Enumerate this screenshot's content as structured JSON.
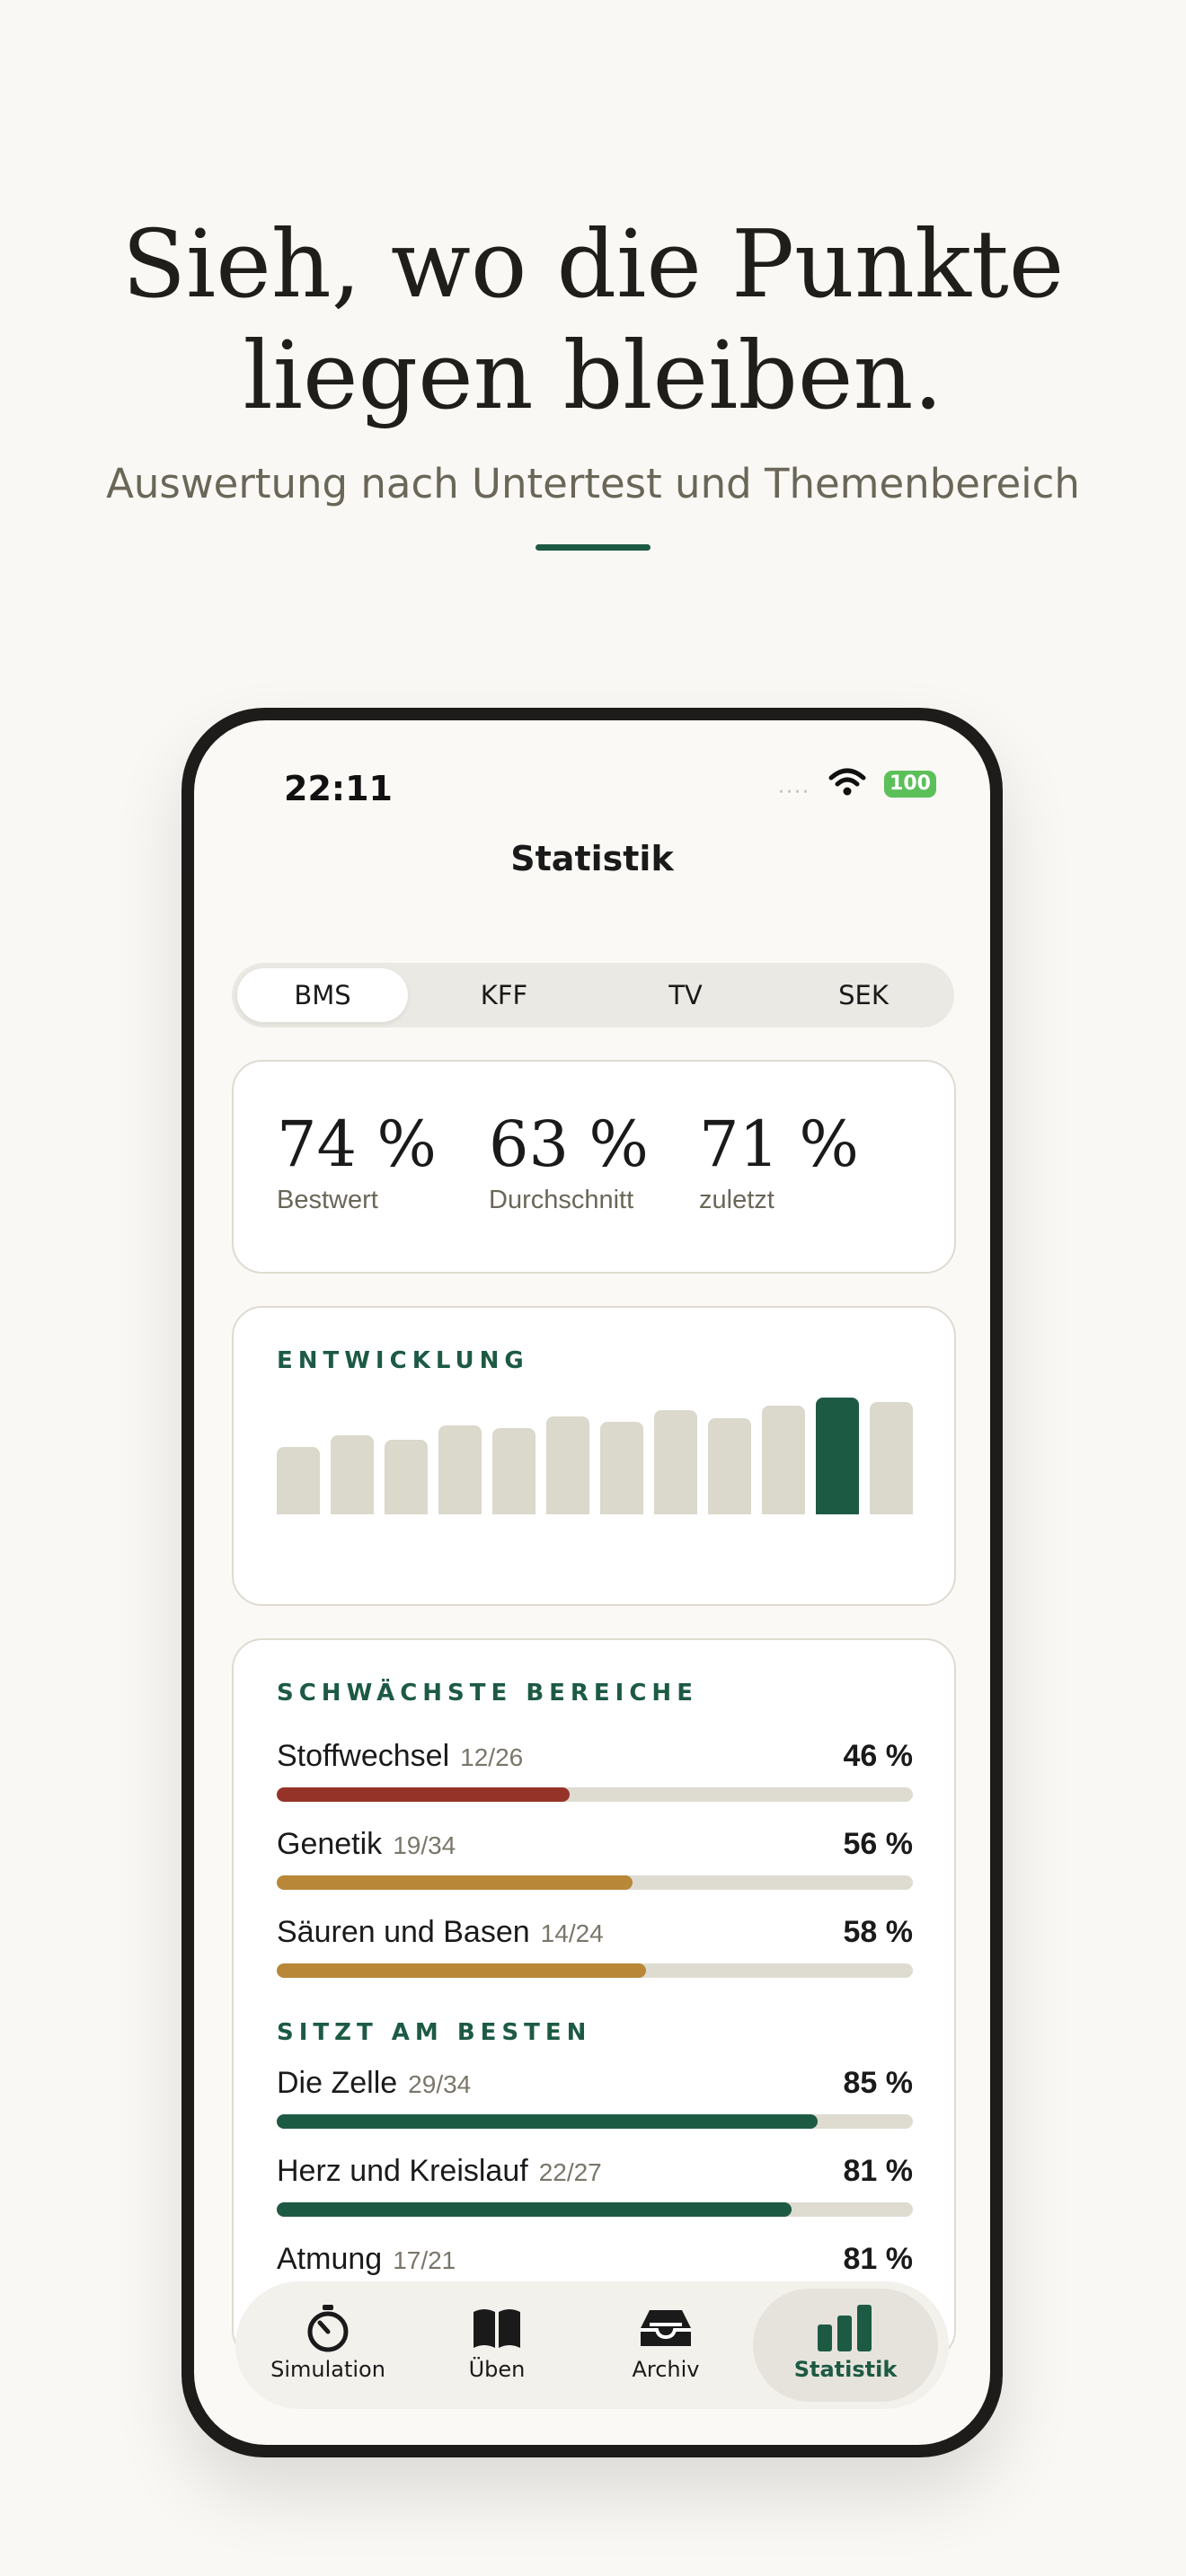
{
  "hero": {
    "headline_line1": "Sieh, wo die Punkte",
    "headline_line2": "liegen bleiben.",
    "subline": "Auswertung nach Untertest und Themenbereich"
  },
  "status_bar": {
    "time": "22:11",
    "battery": "100"
  },
  "screen_title": "Statistik",
  "segments": [
    "BMS",
    "KFF",
    "TV",
    "SEK"
  ],
  "active_segment": "BMS",
  "kpis": [
    {
      "value": "74 %",
      "label": "Bestwert"
    },
    {
      "value": "63 %",
      "label": "Durchschnitt"
    },
    {
      "value": "71 %",
      "label": "zuletzt"
    }
  ],
  "development": {
    "label": "ENTWICKLUNG",
    "bars": [
      0.58,
      0.68,
      0.64,
      0.76,
      0.74,
      0.84,
      0.79,
      0.89,
      0.82,
      0.93,
      1.0,
      0.96
    ],
    "highlight_index": 10,
    "colors": {
      "bar": "#dbd8cc",
      "highlight": "#1d5a44"
    }
  },
  "weakest": {
    "label": "SCHWÄCHSTE BEREICHE",
    "items": [
      {
        "name": "Stoffwechsel",
        "score": "12/26",
        "pct": "46 %",
        "fraction": 0.46,
        "color": "#963329"
      },
      {
        "name": "Genetik",
        "score": "19/34",
        "pct": "56 %",
        "fraction": 0.56,
        "color": "#b88738"
      },
      {
        "name": "Säuren und Basen",
        "score": "14/24",
        "pct": "58 %",
        "fraction": 0.58,
        "color": "#b88738"
      }
    ]
  },
  "best": {
    "label": "SITZT AM BESTEN",
    "items": [
      {
        "name": "Die Zelle",
        "score": "29/34",
        "pct": "85 %",
        "fraction": 0.85,
        "color": "#1d5a44"
      },
      {
        "name": "Herz und Kreislauf",
        "score": "22/27",
        "pct": "81 %",
        "fraction": 0.81,
        "color": "#1d5a44"
      },
      {
        "name": "Atmung",
        "score": "17/21",
        "pct": "81 %",
        "fraction": 0.81,
        "color": "#1d5a44"
      }
    ]
  },
  "tabbar": {
    "items": [
      {
        "label": "Simulation",
        "icon": "stopwatch-icon"
      },
      {
        "label": "Üben",
        "icon": "book-icon"
      },
      {
        "label": "Archiv",
        "icon": "archive-icon"
      },
      {
        "label": "Statistik",
        "icon": "bar-chart-icon"
      }
    ],
    "active": "Statistik"
  },
  "colors": {
    "accent": "#1d5a44",
    "background": "#f9f8f4"
  }
}
